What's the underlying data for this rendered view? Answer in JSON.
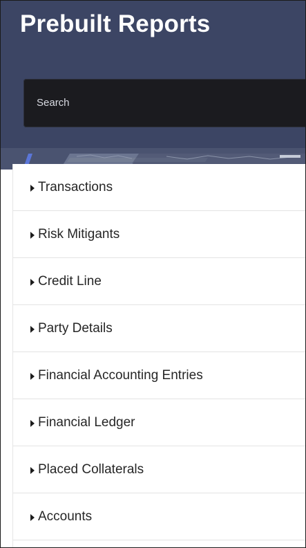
{
  "header": {
    "title": "Prebuilt Reports"
  },
  "search": {
    "placeholder": "Search"
  },
  "report_list": {
    "items": [
      {
        "label": "Transactions"
      },
      {
        "label": "Risk Mitigants"
      },
      {
        "label": "Credit Line"
      },
      {
        "label": "Party Details"
      },
      {
        "label": "Financial Accounting Entries"
      },
      {
        "label": "Financial Ledger"
      },
      {
        "label": "Placed Collaterals"
      },
      {
        "label": "Accounts"
      }
    ]
  },
  "colors": {
    "header_background": "#3c4564",
    "search_background": "#1b1b1f",
    "accent": "#5b76d8",
    "row_divider": "#e3e3e3"
  }
}
